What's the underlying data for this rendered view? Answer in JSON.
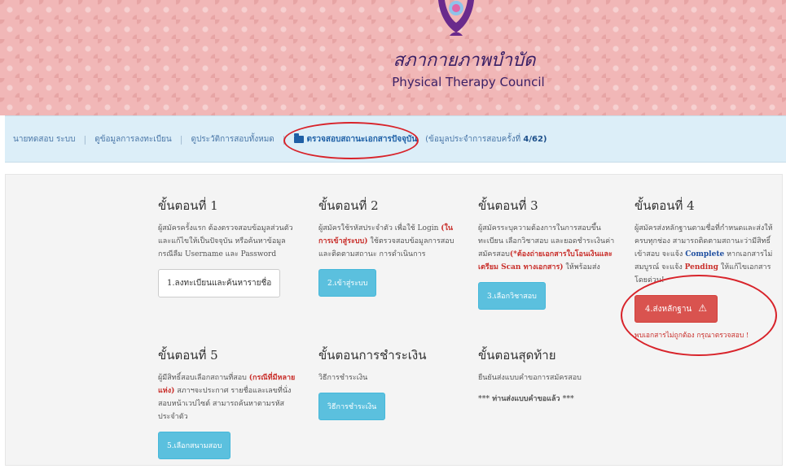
{
  "header": {
    "title_th": "สภากายภาพบำบัด",
    "title_en": "Physical Therapy Council"
  },
  "nav": {
    "items": [
      {
        "label": "นายทดสอบ ระบบ"
      },
      {
        "label": "ดูข้อมูลการลงทะเบียน"
      },
      {
        "label": "ดูประวัติการสอบทั้งหมด"
      }
    ],
    "active_label": "ตรวจสอบสถานะเอกสารปัจจุบัน",
    "note_prefix": "(ข้อมูลประจำการสอบครั้งที่",
    "note_value": "4/62)"
  },
  "steps": {
    "s1": {
      "title": "ขั้นตอนที่ 1",
      "desc": "ผู้สมัครครั้งแรก ต้องตรวจสอบข้อมูลส่วนตัวและแก้ไขให้เป็นปัจจุบัน หรือค้นหาข้อมูลกรณีลืม Username และ Password",
      "button": "1.ลงทะเบียนและค้นหารายชื่อ"
    },
    "s2": {
      "title": "ขั้นตอนที่ 2",
      "desc_a": "ผู้สมัครใช้รหัสประจำตัว เพื่อใช้ Login ",
      "desc_red": "(ในการเข้าสู่ระบบ)",
      "desc_b": " ใช้ตรวจสอบข้อมูลการสอบและติดตามสถานะ การดำเนินการ",
      "button": "2.เข้าสู่ระบบ"
    },
    "s3": {
      "title": "ขั้นตอนที่ 3",
      "desc_a": "ผู้สมัครระบุความต้องการในการสอบขึ้นทะเบียน เลือกวิชาสอบ และยอดชำระเงินค่าสมัครสอบ",
      "desc_red": "(*ต้องถ่ายเอกสารใบโอนเงินและเตรียม Scan ทางเอกสาร)",
      "desc_b": " ให้พร้อมส่ง",
      "button": "3.เลือกวิชาสอบ"
    },
    "s4": {
      "title": "ขั้นตอนที่ 4",
      "desc_a": "ผู้สมัครส่งหลักฐานตามชื่อที่กำหนดและส่งให้ครบทุกช่อง สามารถติดตามสถานะว่ามีสิทธิ์เข้าสอบ จะแจ้ง ",
      "desc_blue": "Complete",
      "desc_b": " หากเอกสารไม่สมบูรณ์ จะแจ้ง ",
      "desc_pending": "Pending",
      "desc_c": " ให้แก้ไขเอกสารโดยด่วน!",
      "button": "4.ส่งหลักฐาน",
      "error": "พบเอกสารไม่ถูกต้อง กรุณาตรวจสอบ !"
    },
    "s5": {
      "title": "ขั้นตอนที่ 5",
      "desc_a": "ผู้มีสิทธิ์สอบเลือกสถานที่สอบ ",
      "desc_red": "(กรณีที่มีหลายแห่ง)",
      "desc_b": " สภาฯจะประกาศ รายชื่อและเลขที่นั่งสอบหน้าเวปไซต์ สามารถค้นหาตามรหัสประจำตัว",
      "button": "5.เลือกสนามสอบ"
    },
    "pay": {
      "title": "ขั้นตอนการชำระเงิน",
      "desc": "วิธีการชำระเงิน",
      "button": "วิธีการชำระเงิน"
    },
    "final": {
      "title": "ขั้นตอนสุดท้าย",
      "desc": "ยืนยันส่งแบบคำขอการสมัครสอบ",
      "status": "*** ท่านส่งแบบคำขอแล้ว ***"
    }
  },
  "colors": {
    "banner_bg": "#f1b7b7",
    "navbar_bg": "#dceef8",
    "btn_info": "#5bc0de",
    "btn_danger": "#d9534f",
    "annotation_red": "#d8232a"
  }
}
